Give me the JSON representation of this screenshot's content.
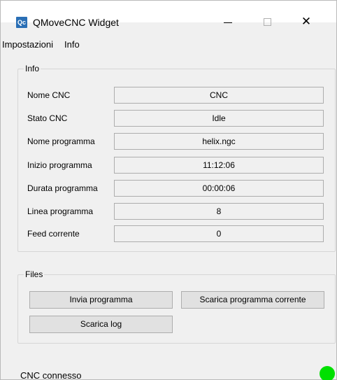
{
  "window": {
    "title": "QMoveCNC Widget",
    "icon_text": "Qc",
    "controls": [
      "minimize",
      "maximize",
      "close"
    ]
  },
  "menu": {
    "items": [
      "Impostazioni",
      "Info"
    ]
  },
  "info_group": {
    "title": "Info",
    "fields": [
      {
        "label": "Nome CNC",
        "value": "CNC"
      },
      {
        "label": "Stato CNC",
        "value": "Idle"
      },
      {
        "label": "Nome programma",
        "value": "helix.ngc"
      },
      {
        "label": "Inizio programma",
        "value": "11:12:06"
      },
      {
        "label": "Durata programma",
        "value": "00:00:06"
      },
      {
        "label": "Linea programma",
        "value": "8"
      },
      {
        "label": "Feed corrente",
        "value": "0"
      }
    ]
  },
  "files_group": {
    "title": "Files",
    "buttons": {
      "send": "Invia programma",
      "download_current": "Scarica programma corrente",
      "download_log": "Scarica log"
    }
  },
  "status": {
    "text": "CNC connesso",
    "led_color": "#00e000"
  },
  "icons": {
    "close": "✕"
  }
}
